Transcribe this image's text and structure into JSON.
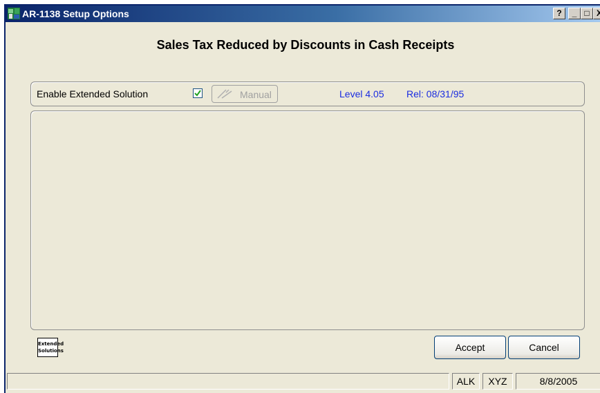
{
  "window": {
    "title": "AR-1138 Setup Options",
    "controls": {
      "help": "?",
      "minimize": "_",
      "maximize": "□",
      "close": "X"
    }
  },
  "heading": "Sales Tax Reduced by Discounts in Cash Receipts",
  "options": {
    "enable_label": "Enable Extended Solution",
    "enable_checked": true,
    "manual_label": "Manual",
    "level": "Level 4.05",
    "release": "Rel: 08/31/95"
  },
  "logo": {
    "line1": "Extended",
    "line2": "Solutions"
  },
  "buttons": {
    "accept": "Accept",
    "cancel": "Cancel"
  },
  "statusbar": {
    "message": "",
    "company": "ALK",
    "user": "XYZ",
    "date": "8/8/2005"
  },
  "colors": {
    "title_gradient_start": "#0a246a",
    "title_gradient_end": "#a6caf0",
    "info_text": "#1a2ce0",
    "window_bg": "#ece9d8"
  }
}
